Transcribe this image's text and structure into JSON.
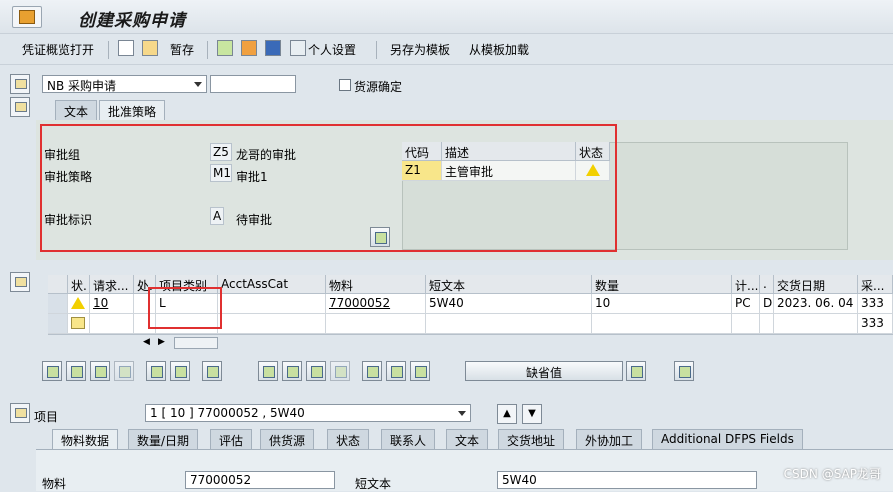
{
  "window": {
    "title": "创建采购申请"
  },
  "toolbar": {
    "doc_overview": "凭证概览打开",
    "save": "暂存",
    "personal_settings": "个人设置",
    "save_as_template": "另存为模板",
    "load_from_template": "从模板加载"
  },
  "header": {
    "doc_type": "NB 采购申请",
    "doc_number": "",
    "source_determination": "货源确定"
  },
  "header_tabs": [
    "文本",
    "批准策略"
  ],
  "approval": {
    "group_label": "审批组",
    "group_code": "Z5",
    "group_desc": "龙哥的审批",
    "strategy_label": "审批策略",
    "strategy_code": "M1",
    "strategy_desc": "审批1",
    "indicator_label": "审批标识",
    "indicator_code": "A",
    "indicator_desc": "待审批",
    "table_headers": [
      "代码",
      "描述",
      "状态"
    ],
    "table_rows": [
      {
        "code": "Z1",
        "desc": "主管审批",
        "status": "warning"
      }
    ]
  },
  "items_table": {
    "headers": [
      "状.",
      "请求...",
      "处.",
      "项目类别",
      "AcctAssCat",
      "物料",
      "短文本",
      "数量",
      "计...",
      ".",
      "交货日期",
      "采..."
    ],
    "rows": [
      {
        "status": "warning",
        "item": "10",
        "proc": "",
        "item_cat": "L",
        "acct": "",
        "material": "77000052",
        "short_text": "5W40",
        "qty": "10",
        "unit": "PC",
        "cat": "D",
        "delivery_date": "2023. 06. 04",
        "pgrp": "333"
      },
      {
        "status": "",
        "item": "",
        "proc": "",
        "item_cat": "",
        "acct": "",
        "material": "",
        "short_text": "",
        "qty": "",
        "unit": "",
        "cat": "",
        "delivery_date": "",
        "pgrp": "333"
      }
    ]
  },
  "buttons": {
    "default_values": "缺省值"
  },
  "item_detail": {
    "label": "项目",
    "selected_item": "1 [ 10 ] 77000052 , 5W40",
    "tabs": [
      "物料数据",
      "数量/日期",
      "评估",
      "供货源",
      "状态",
      "联系人",
      "文本",
      "交货地址",
      "外协加工",
      "Additional DFPS Fields"
    ],
    "material_label": "物料",
    "material_value": "77000052",
    "short_text_label": "短文本",
    "short_text_value": "5W40"
  },
  "watermark": "CSDN @SAP龙哥",
  "colors": {
    "highlight_red": "#e03030",
    "warning_yellow": "#f2d000"
  }
}
